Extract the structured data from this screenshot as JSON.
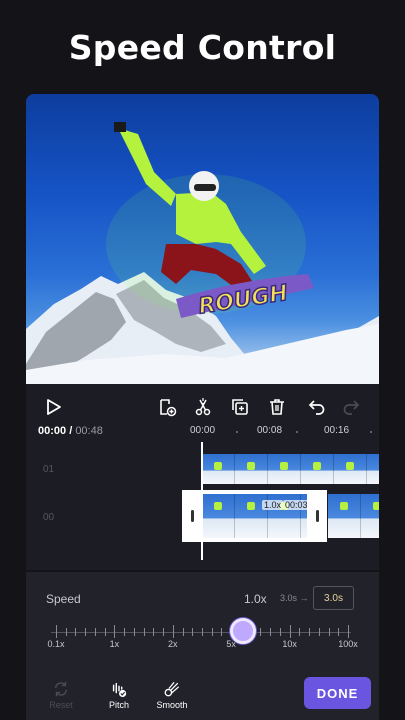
{
  "headline": "Speed Control",
  "toolbar": {
    "icons": [
      "play-icon",
      "add-clip-icon",
      "split-icon",
      "duplicate-icon",
      "delete-icon",
      "undo-icon",
      "redo-icon"
    ]
  },
  "timeline": {
    "current_time": "00:00",
    "total_time": "00:48",
    "ruler_labels": [
      "00:00",
      "00:08",
      "00:16"
    ],
    "track_numbers": [
      "01",
      "00"
    ],
    "clip_speed": "1.0x",
    "clip_duration": "00:03"
  },
  "speed_panel": {
    "label": "Speed",
    "value": "1.0x",
    "duration_from": "3.0s",
    "duration_arrow": "→",
    "duration_to": "3.0s",
    "scale_labels": [
      "0.1x",
      "1x",
      "2x",
      "5x",
      "10x",
      "100x"
    ],
    "selected_index": 3
  },
  "footer": {
    "reset_label": "Reset",
    "pitch_label": "Pitch",
    "smooth_label": "Smooth",
    "done_label": "DONE"
  },
  "colors": {
    "accent": "#6a55e0",
    "knob": "#bfa9ff",
    "background": "#131318"
  }
}
